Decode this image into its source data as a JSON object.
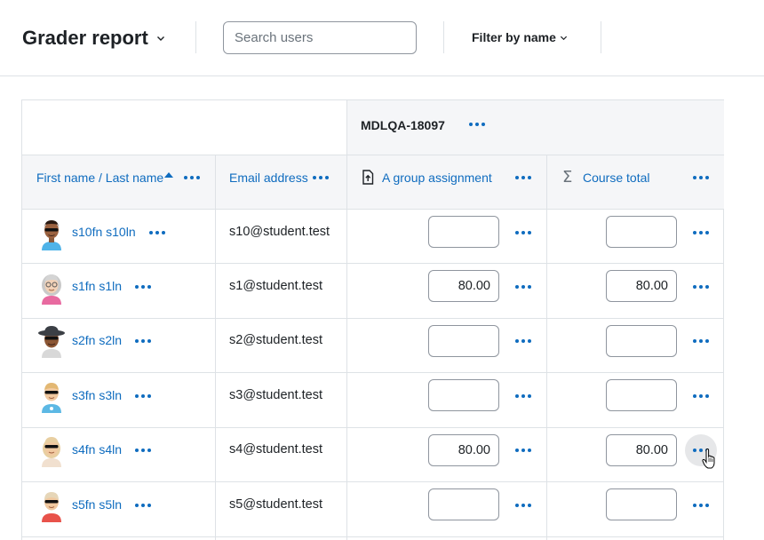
{
  "header": {
    "title": "Grader report",
    "search_placeholder": "Search users",
    "filter_label": "Filter by name"
  },
  "table": {
    "category_header": "MDLQA-18097",
    "columns": {
      "name": "First name / Last name",
      "email": "Email address",
      "assignment": "A group assignment",
      "total": "Course total"
    },
    "rows": [
      {
        "name": "s10fn s10ln",
        "email": "s10@student.test",
        "assignment": "",
        "total": ""
      },
      {
        "name": "s1fn s1ln",
        "email": "s1@student.test",
        "assignment": "80.00",
        "total": "80.00"
      },
      {
        "name": "s2fn s2ln",
        "email": "s2@student.test",
        "assignment": "",
        "total": ""
      },
      {
        "name": "s3fn s3ln",
        "email": "s3@student.test",
        "assignment": "",
        "total": ""
      },
      {
        "name": "s4fn s4ln",
        "email": "s4@student.test",
        "assignment": "80.00",
        "total": "80.00"
      },
      {
        "name": "s5fn s5ln",
        "email": "s5@student.test",
        "assignment": "",
        "total": ""
      }
    ]
  },
  "icons": {
    "title_chevron": "chevron-down-icon",
    "filter_chevron": "chevron-down-icon",
    "sort": "sort-ascending-icon",
    "assignment": "assignment-upload-icon",
    "total": "sigma-icon",
    "actions": "more-actions-icon"
  },
  "colors": {
    "link": "#0f6cbf",
    "header_bg": "#f5f6f8",
    "border": "#dee2e6"
  }
}
